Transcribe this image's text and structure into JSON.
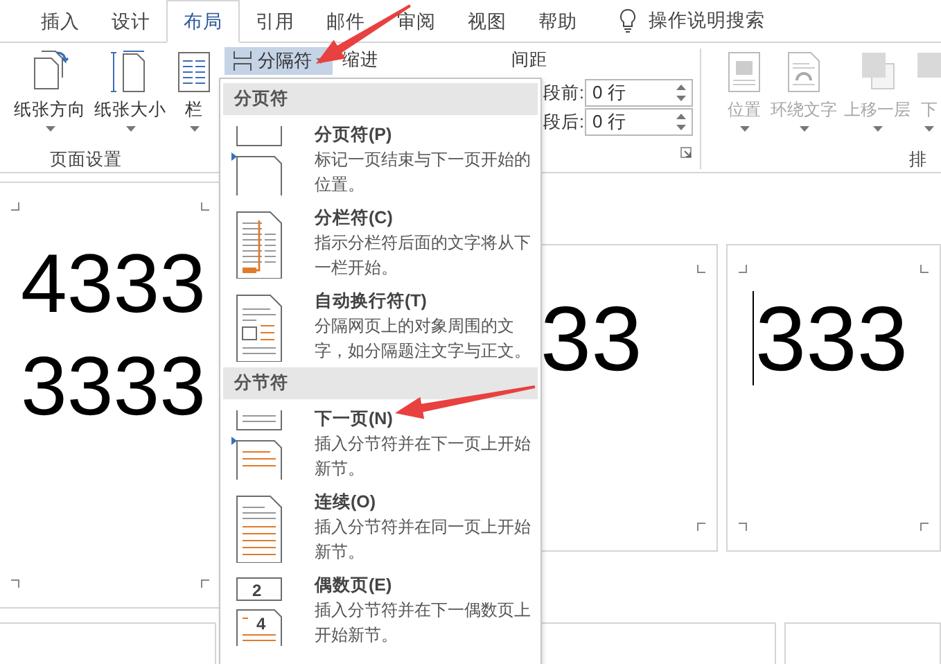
{
  "tabs": [
    {
      "label": "插入",
      "selected": false
    },
    {
      "label": "设计",
      "selected": false
    },
    {
      "label": "布局",
      "selected": true
    },
    {
      "label": "引用",
      "selected": false
    },
    {
      "label": "邮件",
      "selected": false
    },
    {
      "label": "审阅",
      "selected": false
    },
    {
      "label": "视图",
      "selected": false
    },
    {
      "label": "帮助",
      "selected": false
    }
  ],
  "search": {
    "label": "操作说明搜索"
  },
  "ribbon": {
    "page_setup": {
      "buttons": [
        {
          "kind": "orientation",
          "label": "纸张方向"
        },
        {
          "kind": "size",
          "label": "纸张大小"
        },
        {
          "kind": "columns",
          "label": "栏"
        }
      ],
      "group_label": "页面设置"
    },
    "breaks_button": {
      "label": "分隔符",
      "expanded": true
    },
    "indent_label": "缩进",
    "spacing_label": "间距",
    "spacing_fields": [
      {
        "label": "段前:",
        "value": "0 行"
      },
      {
        "label": "段后:",
        "value": "0 行"
      }
    ],
    "arrange": {
      "buttons": [
        {
          "kind": "position",
          "label": "位置",
          "disabled": true
        },
        {
          "kind": "wrap",
          "label": "环绕文字",
          "disabled": true
        },
        {
          "kind": "forward",
          "label": "上移一层",
          "disabled": true
        },
        {
          "kind": "backward",
          "label": "下",
          "disabled": true
        }
      ],
      "group_label": "排"
    }
  },
  "menu": {
    "sections": [
      {
        "header": "分页符",
        "items": [
          {
            "kind": "page",
            "title": "分页符(P)",
            "description": "标记一页结束与下一页开始的位置。"
          },
          {
            "kind": "column",
            "title": "分栏符(C)",
            "description": "指示分栏符后面的文字将从下一栏开始。"
          },
          {
            "kind": "wrapping",
            "title": "自动换行符(T)",
            "description": "分隔网页上的对象周围的文字，如分隔题注文字与正文。"
          }
        ]
      },
      {
        "header": "分节符",
        "items": [
          {
            "kind": "next",
            "title": "下一页(N)",
            "description": "插入分节符并在下一页上开始新节。"
          },
          {
            "kind": "continuous",
            "title": "连续(O)",
            "description": "插入分节符并在同一页上开始新节。"
          },
          {
            "kind": "even",
            "icon_labels": [
              "2",
              "4"
            ],
            "title": "偶数页(E)",
            "description": "插入分节符并在下一偶数页上开始新节。"
          }
        ]
      }
    ]
  },
  "document": {
    "pages": [
      {
        "lines": [
          "4333",
          "3333"
        ],
        "cursor": false
      },
      {
        "lines": [
          "33"
        ],
        "cursor": false
      },
      {
        "lines": [
          "333"
        ],
        "cursor": true
      }
    ]
  }
}
